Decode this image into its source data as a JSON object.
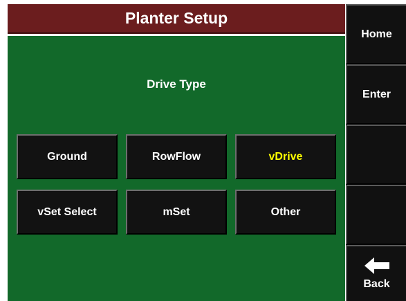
{
  "title": "Planter Setup",
  "prompt": "Drive Type",
  "options": [
    {
      "label": "Ground",
      "selected": false
    },
    {
      "label": "RowFlow",
      "selected": false
    },
    {
      "label": "vDrive",
      "selected": true
    },
    {
      "label": "vSet Select",
      "selected": false
    },
    {
      "label": "mSet",
      "selected": false
    },
    {
      "label": "Other",
      "selected": false
    }
  ],
  "side_buttons": {
    "home": "Home",
    "enter": "Enter",
    "blank1": "",
    "blank2": "",
    "back": "Back",
    "back_icon": "left-arrow-icon"
  },
  "colors": {
    "title_bar": "#6b1d1e",
    "panel": "#12692a",
    "button": "#121212",
    "selected_text": "#ffff00"
  }
}
